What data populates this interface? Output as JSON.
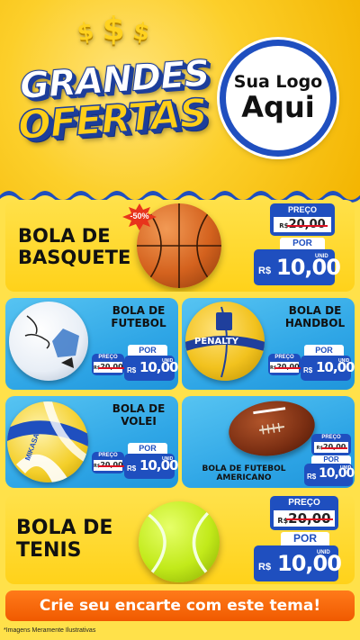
{
  "header": {
    "dollars": [
      "$",
      "$",
      "$"
    ],
    "title_line1": "GRANDES",
    "title_line2": "OFERTAS",
    "logo_line1": "Sua Logo",
    "logo_line2": "Aqui"
  },
  "products": [
    {
      "name": "BOLA DE BASQUETE",
      "name_l1": "BOLA DE",
      "name_l2": "BASQUETE",
      "discount": "-50%",
      "preco_label": "PREÇO",
      "old_currency": "R$",
      "old_price": "20,00",
      "por_label": "POR",
      "currency": "R$",
      "price": "10,00",
      "unid": "UNID"
    },
    {
      "name_l1": "BOLA DE",
      "name_l2": "FUTEBOL",
      "preco_label": "PREÇO",
      "old_currency": "R$",
      "old_price": "20,00",
      "por_label": "POR",
      "currency": "R$",
      "price": "10,00",
      "unid": "UNID"
    },
    {
      "name_l1": "BOLA DE",
      "name_l2": "HANDBOL",
      "preco_label": "PREÇO",
      "old_currency": "R$",
      "old_price": "20,00",
      "por_label": "POR",
      "currency": "R$",
      "price": "10,00",
      "unid": "UNID"
    },
    {
      "name_l1": "BOLA DE",
      "name_l2": "VOLEI",
      "preco_label": "PREÇO",
      "old_currency": "R$",
      "old_price": "20,00",
      "por_label": "POR",
      "currency": "R$",
      "price": "10,00",
      "unid": "UNID"
    },
    {
      "name_l1": "BOLA DE FUTEBOL",
      "name_l2": "AMERICANO",
      "preco_label": "PREÇO",
      "old_currency": "R$",
      "old_price": "20,00",
      "por_label": "POR",
      "currency": "R$",
      "price": "10,00",
      "unid": "UNID"
    },
    {
      "name_l1": "BOLA DE",
      "name_l2": "TENIS",
      "preco_label": "PREÇO",
      "old_currency": "R$",
      "old_price": "20,00",
      "por_label": "POR",
      "currency": "R$",
      "price": "10,00",
      "unid": "UNID"
    }
  ],
  "brands": {
    "soccer": "umbro",
    "handball": "PENALTY",
    "volleyball": "MIKASA"
  },
  "cta": "Crie seu encarte com este tema!",
  "footnote": "*Imagens Meramente Ilustrativas",
  "colors": {
    "brand_blue": "#1f4fbf",
    "yellow": "#ffd21a",
    "orange": "#f05a00",
    "sky": "#2fa6e6",
    "strike": "#dd1122"
  }
}
